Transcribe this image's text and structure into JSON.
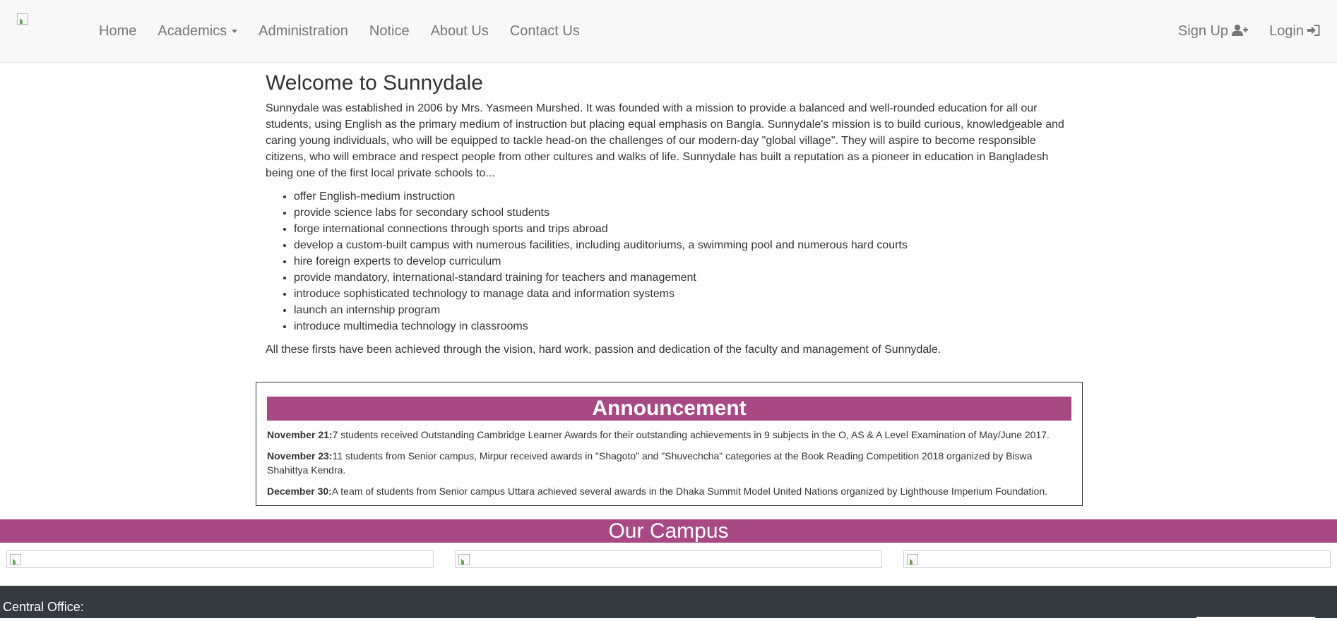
{
  "nav": {
    "home": "Home",
    "academics": "Academics",
    "administration": "Administration",
    "notice": "Notice",
    "about": "About Us",
    "contact": "Contact Us",
    "signup": "Sign Up",
    "login": "Login",
    "icons": {
      "signup": "user-plus-icon",
      "login": "sign-in-icon",
      "academics": "caret-down-icon"
    }
  },
  "main": {
    "title": "Welcome to Sunnydale",
    "intro": "Sunnydale was established in 2006 by Mrs. Yasmeen Murshed. It was founded with a mission to provide a balanced and well-rounded education for all our students, using English as the primary medium of instruction but placing equal emphasis on Bangla. Sunnydale's mission is to build curious, knowledgeable and caring young individuals, who will be equipped to tackle head-on the challenges of our modern-day \"global village\". They will aspire to become responsible citizens, who will embrace and respect people from other cultures and walks of life. Sunnydale has built a reputation as a pioneer in education in Bangladesh being one of the first local private schools to...",
    "features": [
      "offer English-medium instruction",
      "provide science labs for secondary school students",
      "forge international connections through sports and trips abroad",
      "develop a custom-built campus with numerous facilities, including auditoriums, a swimming pool and numerous hard courts",
      "hire foreign experts to develop curriculum",
      "provide mandatory, international-standard training for teachers and management",
      "introduce sophisticated technology to manage data and information systems",
      "launch an internship program",
      "introduce multimedia technology in classrooms"
    ],
    "closing": "All these firsts have been achieved through the vision, hard work, passion and dedication of the faculty and management of Sunnydale."
  },
  "announcement": {
    "heading": "Announcement",
    "items": [
      {
        "date": "November 21:",
        "text": "7 students received Outstanding Cambridge Learner Awards for their outstanding achievements in 9 subjects in the O, AS & A Level Examination of May/June 2017."
      },
      {
        "date": "November 23:",
        "text": "11 students from Senior campus, Mirpur received awards in \"Shagoto\" and \"Shuvechcha\" categories at the Book Reading Competition 2018 organized by Biswa Shahittya Kendra."
      },
      {
        "date": "December 30:",
        "text": "A team of students from Senior campus Uttara achieved several awards in the Dhaka Summit Model United Nations organized by Lighthouse Imperium Foundation."
      }
    ]
  },
  "campus": {
    "heading": "Our Campus"
  },
  "footer": {
    "label": "Central Office:"
  },
  "colors": {
    "accent": "#a84984",
    "navbar": "#f8f8f8",
    "footer": "#343a40",
    "text": "#333333",
    "nav_link": "#777777"
  }
}
